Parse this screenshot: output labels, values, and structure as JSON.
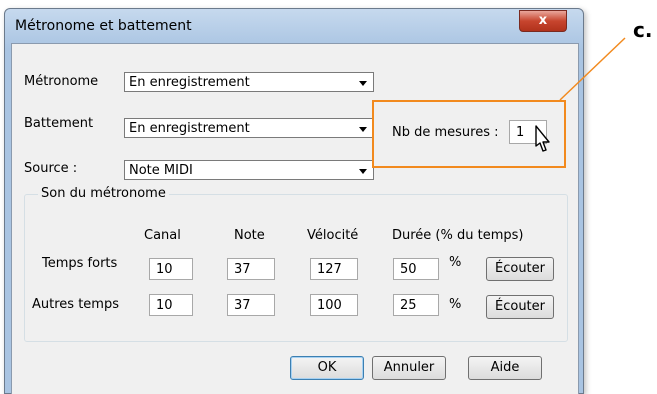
{
  "window": {
    "title": "Métronome et battement",
    "close_glyph": "x"
  },
  "metronome": {
    "label": "Métronome",
    "value": "En enregistrement"
  },
  "beat": {
    "label": "Battement",
    "value": "En enregistrement"
  },
  "source": {
    "label": "Source :",
    "value": "Note MIDI"
  },
  "measures": {
    "label": "Nb de mesures :",
    "value": "1"
  },
  "group": {
    "title": "Son du métronome",
    "headers": {
      "channel": "Canal",
      "note": "Note",
      "velocity": "Vélocité",
      "duration": "Durée (% du temps)"
    },
    "rows": [
      {
        "label": "Temps forts",
        "channel": "10",
        "note": "37",
        "velocity": "127",
        "duration": "50",
        "percent": "%",
        "listen": "Écouter"
      },
      {
        "label": "Autres temps",
        "channel": "10",
        "note": "37",
        "velocity": "100",
        "duration": "25",
        "percent": "%",
        "listen": "Écouter"
      }
    ]
  },
  "buttons": {
    "ok": "OK",
    "cancel": "Annuler",
    "help": "Aide"
  },
  "callout": {
    "label": "c.",
    "color": "#f28a1e"
  }
}
